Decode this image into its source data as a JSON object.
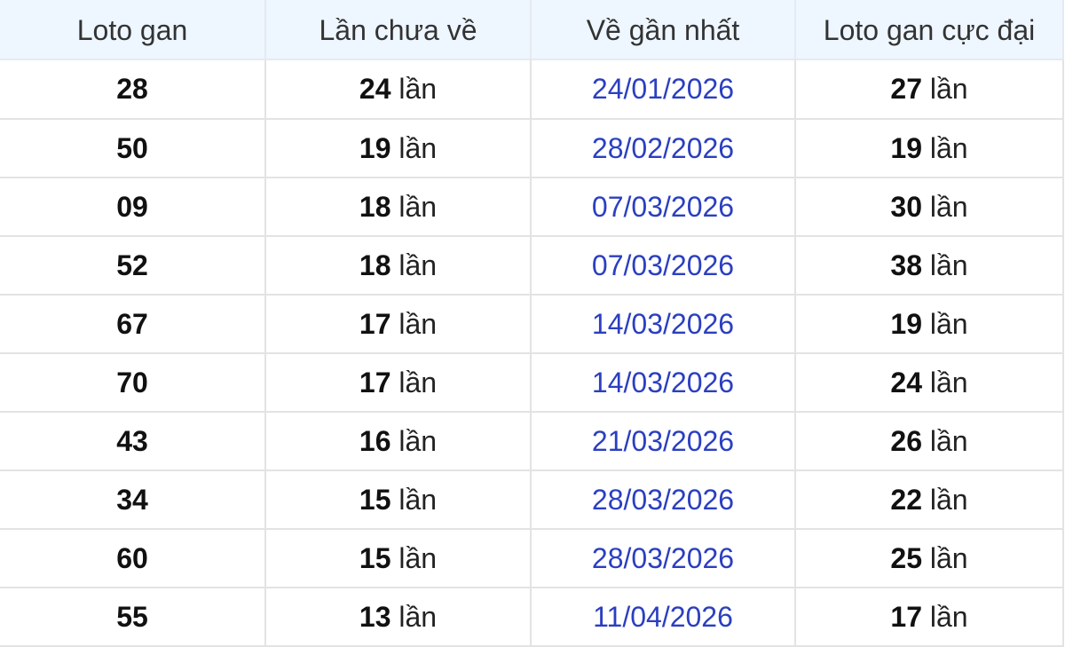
{
  "table": {
    "headers": [
      "Loto gan",
      "Lần chưa về",
      "Về gần nhất",
      "Loto gan cực đại"
    ],
    "unit": "lần",
    "rows": [
      {
        "loto": "28",
        "absent": "24",
        "last_seen": "24/01/2026",
        "max_gap": "27"
      },
      {
        "loto": "50",
        "absent": "19",
        "last_seen": "28/02/2026",
        "max_gap": "19"
      },
      {
        "loto": "09",
        "absent": "18",
        "last_seen": "07/03/2026",
        "max_gap": "30"
      },
      {
        "loto": "52",
        "absent": "18",
        "last_seen": "07/03/2026",
        "max_gap": "38"
      },
      {
        "loto": "67",
        "absent": "17",
        "last_seen": "14/03/2026",
        "max_gap": "19"
      },
      {
        "loto": "70",
        "absent": "17",
        "last_seen": "14/03/2026",
        "max_gap": "24"
      },
      {
        "loto": "43",
        "absent": "16",
        "last_seen": "21/03/2026",
        "max_gap": "26"
      },
      {
        "loto": "34",
        "absent": "15",
        "last_seen": "28/03/2026",
        "max_gap": "22"
      },
      {
        "loto": "60",
        "absent": "15",
        "last_seen": "28/03/2026",
        "max_gap": "25"
      },
      {
        "loto": "55",
        "absent": "13",
        "last_seen": "11/04/2026",
        "max_gap": "17"
      }
    ]
  },
  "colors": {
    "header_bg": "#eef6ff",
    "grid": "#e3e3e3",
    "date_link": "#2b3fc0",
    "text": "#111111"
  }
}
